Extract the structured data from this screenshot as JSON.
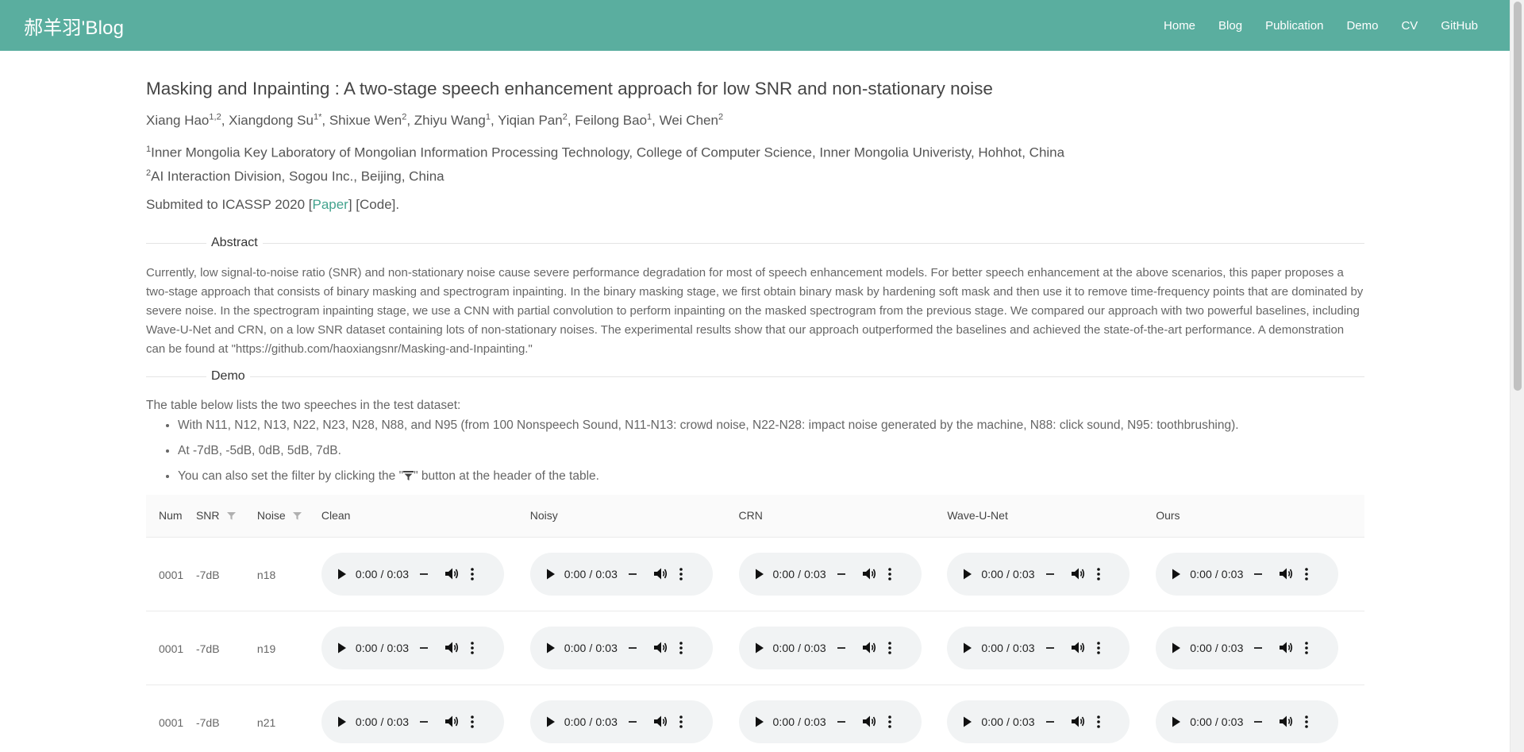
{
  "navbar": {
    "brand": "郝羊羽'Blog",
    "links": [
      "Home",
      "Blog",
      "Publication",
      "Demo",
      "CV",
      "GitHub"
    ]
  },
  "paper": {
    "title": "Masking and Inpainting : A two-stage speech enhancement approach for low SNR and non-stationary noise",
    "authors": [
      {
        "name": "Xiang Hao",
        "sup": "1,2",
        "sep": ", "
      },
      {
        "name": "Xiangdong Su",
        "sup": "1*",
        "sep": ", "
      },
      {
        "name": "Shixue Wen",
        "sup": "2",
        "sep": ", "
      },
      {
        "name": "Zhiyu Wang",
        "sup": "1",
        "sep": ", "
      },
      {
        "name": "Yiqian Pan",
        "sup": "2",
        "sep": ", "
      },
      {
        "name": "Feilong Bao",
        "sup": "1",
        "sep": ", "
      },
      {
        "name": "Wei Chen",
        "sup": "2",
        "sep": ""
      }
    ],
    "affiliations": [
      {
        "sup": "1",
        "text": "Inner Mongolia Key Laboratory of Mongolian Information Processing Technology, College of Computer Science, Inner Mongolia Univeristy, Hohhot, China"
      },
      {
        "sup": "2",
        "text": "AI Interaction Division, Sogou Inc., Beijing, China"
      }
    ],
    "submitted_prefix": "Submited to ICASSP 2020 [",
    "paper_link": "Paper",
    "submitted_suffix": "] [Code]."
  },
  "abstract": {
    "heading": "Abstract",
    "text": "Currently, low signal-to-noise ratio (SNR) and non-stationary noise cause severe performance degradation for most of speech enhancement models. For better speech enhancement at the above scenarios, this paper proposes a two-stage approach that consists of binary masking and spectrogram inpainting. In the binary masking stage, we first obtain binary mask by hardening soft mask and then use it to remove time-frequency points that are dominated by severe noise. In the spectrogram inpainting stage, we use a CNN with partial convolution to perform inpainting on the masked spectrogram from the previous stage. We compared our approach with two powerful baselines, including Wave-U-Net and CRN, on a low SNR dataset containing lots of non-stationary noises. The experimental results show that our approach outperformed the baselines and achieved the state-of-the-art performance. A demonstration can be found at \"https://github.com/haoxiangsnr/Masking-and-Inpainting.\""
  },
  "demo": {
    "heading": "Demo",
    "intro": "The table below lists the two speeches in the test dataset:",
    "bullets": [
      "With N11, N12, N13, N22, N23, N28, N88, and N95 (from 100 Nonspeech Sound, N11-N13: crowd noise, N22-N28: impact noise generated by the machine, N88: click sound, N95: toothbrushing).",
      "At -7dB, -5dB, 0dB, 5dB, 7dB."
    ],
    "bullet3_prefix": "You can also set the filter by clicking the \"",
    "bullet3_suffix": "\" button at the header of the table."
  },
  "table": {
    "headers": [
      "Num",
      "SNR",
      "Noise",
      "Clean",
      "Noisy",
      "CRN",
      "Wave-U-Net",
      "Ours"
    ],
    "rows": [
      {
        "num": "0001",
        "snr": "-7dB",
        "noise": "n18"
      },
      {
        "num": "0001",
        "snr": "-7dB",
        "noise": "n19"
      },
      {
        "num": "0001",
        "snr": "-7dB",
        "noise": "n21"
      }
    ],
    "audio_time": "0:00 / 0:03"
  },
  "colors": {
    "navbar": "#5aae9f",
    "link": "#43a38e"
  },
  "icons": [
    "play-icon",
    "volume-icon",
    "more-icon",
    "filter-icon"
  ]
}
